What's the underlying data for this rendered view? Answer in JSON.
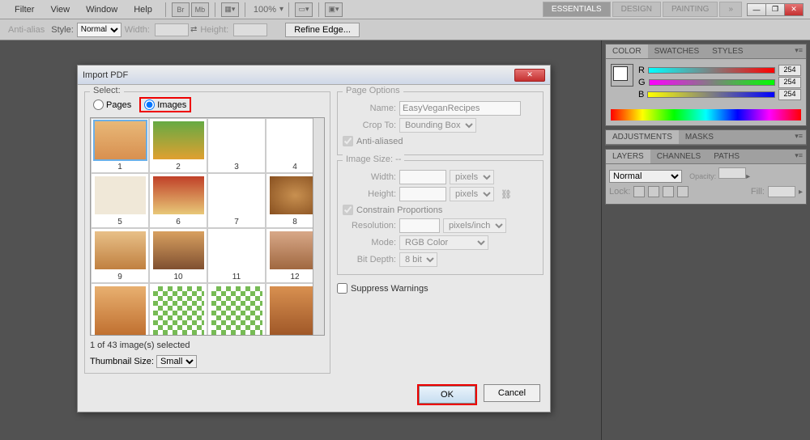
{
  "menu": {
    "filter": "Filter",
    "view": "View",
    "window": "Window",
    "help": "Help",
    "zoom": "100%",
    "br": "Br",
    "mb": "Mb"
  },
  "workspaces": {
    "essentials": "ESSENTIALS",
    "design": "DESIGN",
    "painting": "PAINTING"
  },
  "toolbar": {
    "antialias": "Anti-alias",
    "style": "Style:",
    "styleval": "Normal",
    "width": "Width:",
    "height": "Height:",
    "refine": "Refine Edge..."
  },
  "dialog": {
    "title": "Import PDF",
    "select": "Select:",
    "pages": "Pages",
    "images": "Images",
    "status": "1 of 43 image(s) selected",
    "thumbsize": "Thumbnail Size:",
    "thumbsizeval": "Small",
    "pageoptions": "Page Options",
    "name": "Name:",
    "nameval": "EasyVeganRecipes",
    "cropto": "Crop To:",
    "croptoval": "Bounding Box",
    "antialiased": "Anti-aliased",
    "imagesize": "Image Size: --",
    "widthl": "Width:",
    "heightl": "Height:",
    "pixels": "pixels",
    "constrain": "Constrain Proportions",
    "resolution": "Resolution:",
    "resunit": "pixels/inch",
    "mode": "Mode:",
    "modeval": "RGB Color",
    "bitdepth": "Bit Depth:",
    "bitdepthval": "8 bit",
    "suppress": "Suppress Warnings",
    "ok": "OK",
    "cancel": "Cancel",
    "thumbs": [
      1,
      2,
      3,
      4,
      5,
      6,
      7,
      8,
      9,
      10,
      11,
      12
    ]
  },
  "panels": {
    "color": "COLOR",
    "swatches": "SWATCHES",
    "styles": "STYLES",
    "r": "R",
    "g": "G",
    "b": "B",
    "val254": "254",
    "adjustments": "ADJUSTMENTS",
    "masks": "MASKS",
    "layers": "LAYERS",
    "channels": "CHANNELS",
    "paths": "PATHS",
    "normal": "Normal",
    "opacity": "Opacity:",
    "lock": "Lock:",
    "fill": "Fill:"
  }
}
